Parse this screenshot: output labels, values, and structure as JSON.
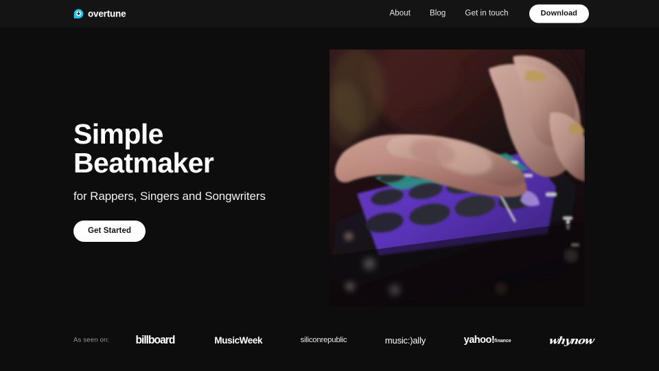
{
  "brand": {
    "name": "overtune",
    "icon": "overtune-logo-icon",
    "accent": "#22c8ea"
  },
  "nav": {
    "links": [
      {
        "label": "About"
      },
      {
        "label": "Blog"
      },
      {
        "label": "Get in touch"
      }
    ],
    "cta": {
      "label": "Download"
    }
  },
  "hero": {
    "title": "Simple\nBeatmaker",
    "subtitle": "for Rappers, Singers and Songwriters",
    "cta": {
      "label": "Get Started"
    },
    "media": {
      "alt": "Hand tapping purple drum-pad grid on a phone screen"
    }
  },
  "press": {
    "label": "As seen on:",
    "logos": [
      {
        "name": "billboard",
        "text": "billboard"
      },
      {
        "name": "musicweek",
        "text": "MusicWeek"
      },
      {
        "name": "siliconrepublic",
        "text": "siliconrepublic"
      },
      {
        "name": "musically",
        "text": "music:)ally"
      },
      {
        "name": "yahoo-finance",
        "text": "yahoo!",
        "text2": "finance"
      },
      {
        "name": "whynow",
        "text": "whynow"
      }
    ]
  },
  "theme": {
    "page_background": "#0d0d0d",
    "header_background": "#141414",
    "text_primary": "#ffffff",
    "text_muted": "#9a9a9a"
  }
}
